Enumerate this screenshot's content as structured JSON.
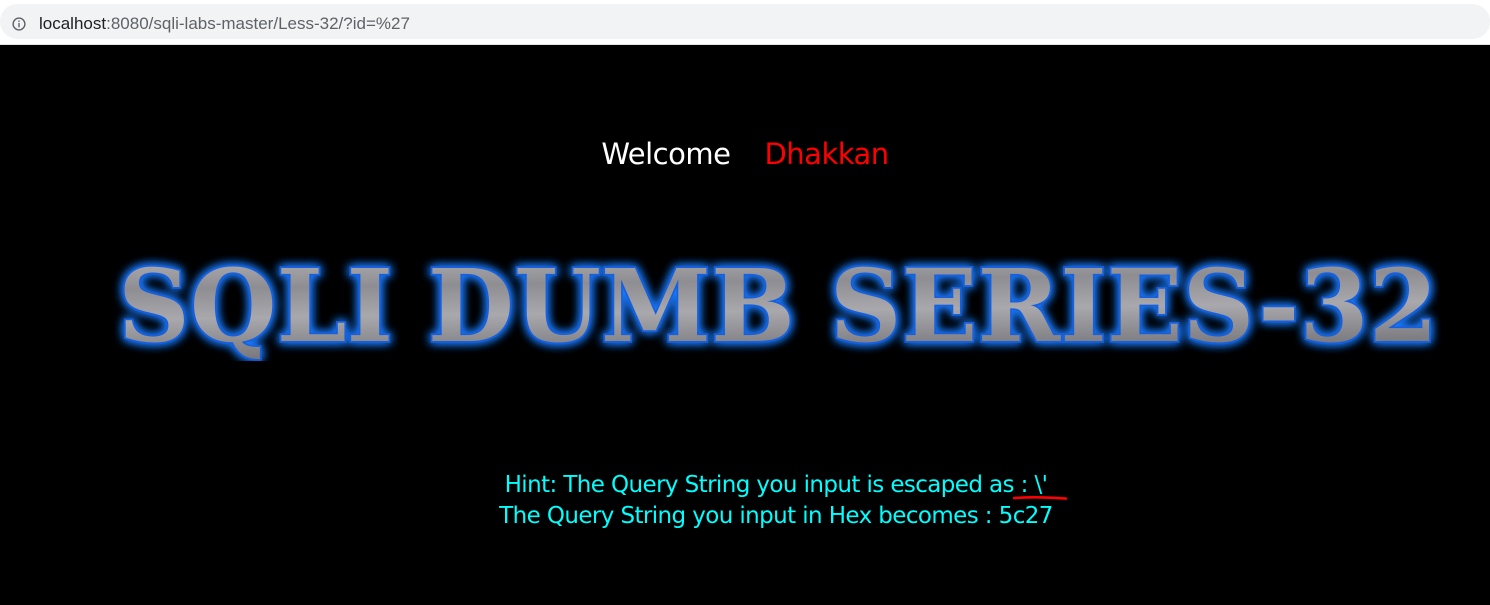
{
  "browser": {
    "url_host": "localhost",
    "url_rest": ":8080/sqli-labs-master/Less-32/?id=%27",
    "site_info_icon": "info-circle-icon"
  },
  "page": {
    "welcome_word": "Welcome",
    "welcome_name": "Dhakkan",
    "banner_text": "SQLI DUMB SERIES-32",
    "hint_label": "Hint: The Query String you input is escaped as ",
    "hint_value": ": \\'",
    "hex_line": "The Query String you input in Hex becomes : 5c27"
  },
  "colors": {
    "background": "#000000",
    "welcome_word": "#ffffff",
    "welcome_name": "#ff0000",
    "hint_text": "#00ffff",
    "banner_glow": "#1e7bff",
    "annotation_mark": "#ff0000"
  }
}
